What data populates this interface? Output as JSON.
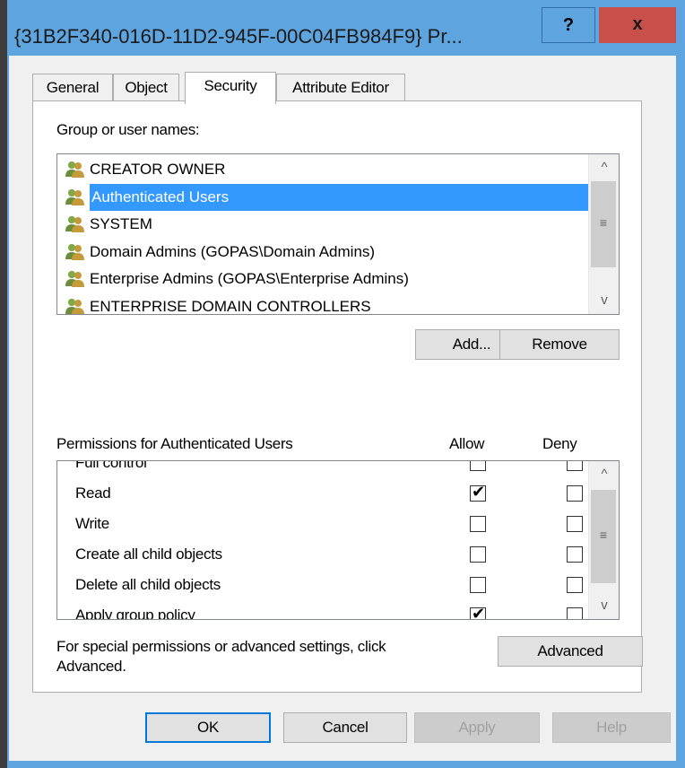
{
  "window": {
    "title": "{31B2F340-016D-11D2-945F-00C04FB984F9} Pr...",
    "help_label": "?",
    "close_label": "x"
  },
  "tabs": [
    {
      "label": "General",
      "active": false
    },
    {
      "label": "Object",
      "active": false
    },
    {
      "label": "Security",
      "active": true
    },
    {
      "label": "Attribute Editor",
      "active": false
    }
  ],
  "security": {
    "group_label": "Group or user names:",
    "users": [
      {
        "name": "CREATOR OWNER",
        "selected": false
      },
      {
        "name": "Authenticated Users",
        "selected": true
      },
      {
        "name": "SYSTEM",
        "selected": false
      },
      {
        "name": "Domain Admins (GOPAS\\Domain Admins)",
        "selected": false
      },
      {
        "name": "Enterprise Admins (GOPAS\\Enterprise Admins)",
        "selected": false
      },
      {
        "name": "ENTERPRISE DOMAIN CONTROLLERS",
        "selected": false
      }
    ],
    "add_label": "Add...",
    "remove_label": "Remove",
    "permissions_label": "Permissions for Authenticated Users",
    "allow_label": "Allow",
    "deny_label": "Deny",
    "permissions": [
      {
        "name": "Full control",
        "allow": false,
        "deny": false
      },
      {
        "name": "Read",
        "allow": true,
        "deny": false
      },
      {
        "name": "Write",
        "allow": false,
        "deny": false
      },
      {
        "name": "Create all child objects",
        "allow": false,
        "deny": false
      },
      {
        "name": "Delete all child objects",
        "allow": false,
        "deny": false
      },
      {
        "name": "Apply group policy",
        "allow": true,
        "deny": false
      }
    ],
    "advanced_text_line1": "For special permissions or advanced settings, click",
    "advanced_text_line2": "Advanced.",
    "advanced_label": "Advanced"
  },
  "footer": {
    "ok_label": "OK",
    "cancel_label": "Cancel",
    "apply_label": "Apply",
    "help_label": "Help"
  },
  "icons": {
    "user_group": "user-group-icon",
    "scroll_up": "scroll-up-icon",
    "scroll_down": "scroll-down-icon",
    "checkmark": "checkmark-icon"
  },
  "colors": {
    "title_bar": "#5ea4df",
    "close_button": "#c7504a",
    "selection": "#3399ff"
  }
}
